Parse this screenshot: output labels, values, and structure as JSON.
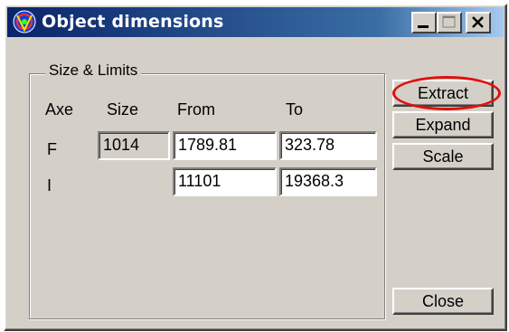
{
  "window": {
    "title": "Object dimensions",
    "app_icon": "globe-icon"
  },
  "titlebar_buttons": {
    "minimize": "minimize-icon",
    "maximize": "maximize-icon",
    "close": "close-icon"
  },
  "group": {
    "title": "Size & Limits",
    "headers": {
      "axe": "Axe",
      "size": "Size",
      "from": "From",
      "to": "To"
    },
    "rows": [
      {
        "axe": "F",
        "size": "1014",
        "from": "1789.81",
        "to": "323.78"
      },
      {
        "axe": "I",
        "size": "",
        "from": "11101",
        "to": "19368.3"
      }
    ]
  },
  "buttons": {
    "extract": "Extract",
    "expand": "Expand",
    "scale": "Scale",
    "close": "Close"
  },
  "colors": {
    "window_bg": "#d4d0c8",
    "title_bg": "#0a246a",
    "highlight": "#e01010"
  }
}
